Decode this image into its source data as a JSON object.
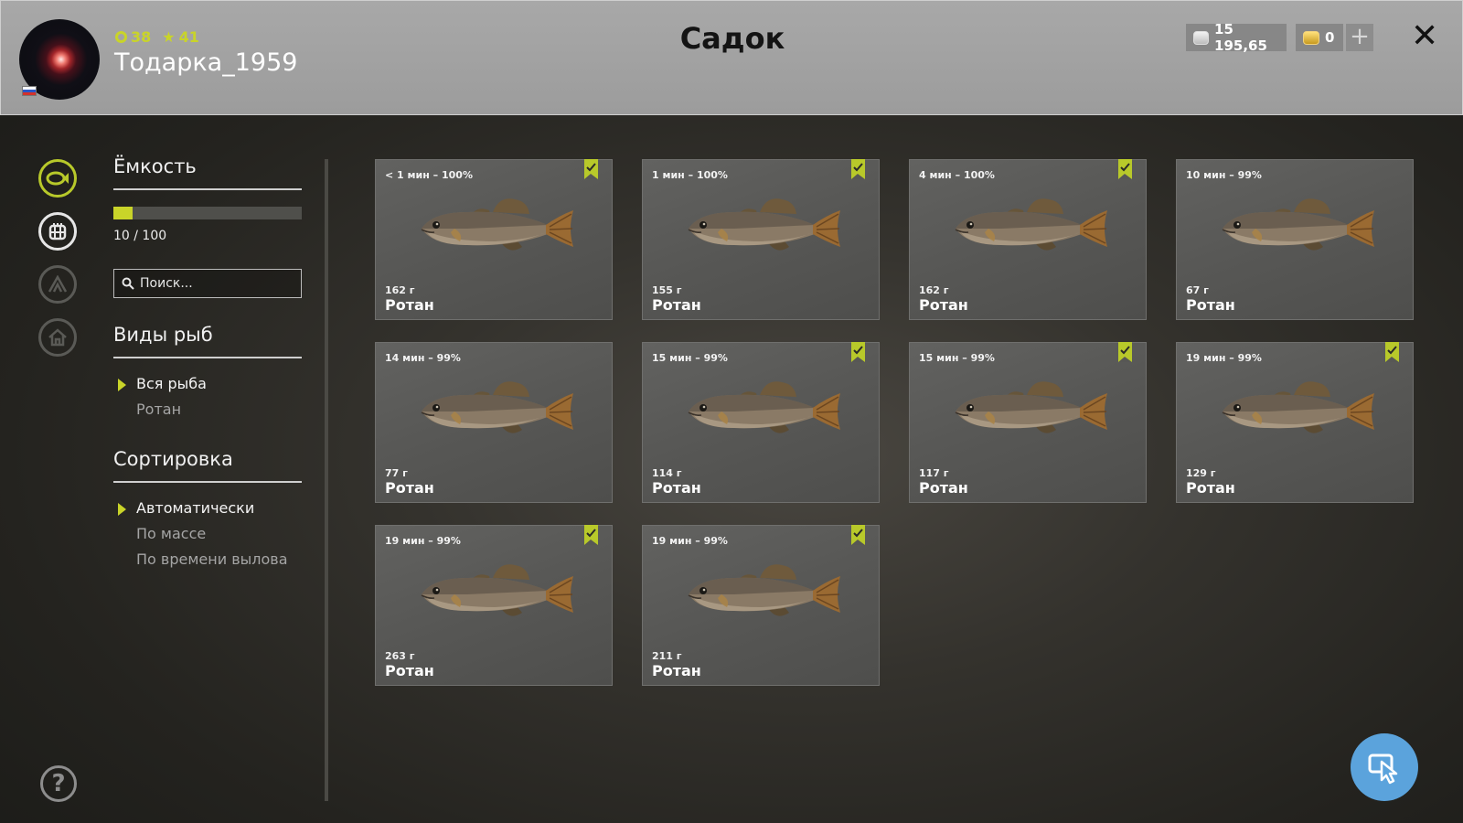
{
  "player": {
    "level": "38",
    "rank": "41",
    "name": "Тодарка_1959"
  },
  "window": {
    "title": "Садок"
  },
  "currency": {
    "silver": "15 195,65",
    "gold": "0",
    "add_label": "+",
    "close_label": "✕"
  },
  "filters": {
    "capacity_title": "Ёмкость",
    "capacity_text": "10 / 100",
    "capacity_fraction": 0.1,
    "search_placeholder": "Поиск...",
    "species_title": "Виды рыб",
    "species_items": [
      "Вся рыба",
      "Ротан"
    ],
    "sort_title": "Сортировка",
    "sort_items": [
      "Автоматически",
      "По массе",
      "По времени вылова"
    ]
  },
  "fish": [
    {
      "time": "< 1 мин – 100%",
      "weight": "162 г",
      "name": "Ротан",
      "marked": true
    },
    {
      "time": "1 мин – 100%",
      "weight": "155 г",
      "name": "Ротан",
      "marked": true
    },
    {
      "time": "4 мин – 100%",
      "weight": "162 г",
      "name": "Ротан",
      "marked": true
    },
    {
      "time": "10 мин – 99%",
      "weight": "67 г",
      "name": "Ротан",
      "marked": false
    },
    {
      "time": "14 мин – 99%",
      "weight": "77 г",
      "name": "Ротан",
      "marked": false
    },
    {
      "time": "15 мин – 99%",
      "weight": "114 г",
      "name": "Ротан",
      "marked": true
    },
    {
      "time": "15 мин – 99%",
      "weight": "117 г",
      "name": "Ротан",
      "marked": true
    },
    {
      "time": "19 мин – 99%",
      "weight": "129 г",
      "name": "Ротан",
      "marked": true
    },
    {
      "time": "19 мин – 99%",
      "weight": "263 г",
      "name": "Ротан",
      "marked": true
    },
    {
      "time": "19 мин – 99%",
      "weight": "211 г",
      "name": "Ротан",
      "marked": true
    }
  ],
  "icons": {
    "help": "?"
  },
  "colors": {
    "accent": "#c9d429",
    "fab": "#5ba3dc"
  }
}
